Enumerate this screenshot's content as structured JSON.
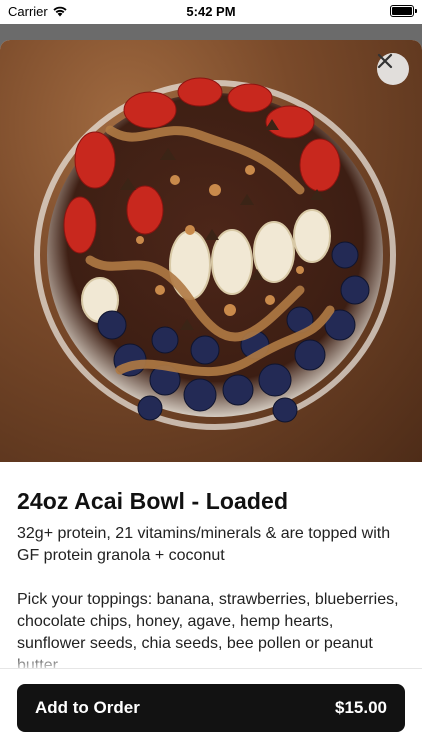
{
  "status_bar": {
    "carrier": "Carrier",
    "time": "5:42 PM",
    "battery_level": 1.0
  },
  "item": {
    "title": "24oz Acai Bowl - Loaded",
    "description": "32g+ protein, 21 vitamins/minerals & are topped with GF protein granola + coconut",
    "toppings": "Pick your toppings: banana, strawberries, blueberries, chocolate chips, honey, agave, hemp hearts, sunflower seeds, chia seeds, bee pollen or peanut butter"
  },
  "footer": {
    "add_label": "Add to Order",
    "price": "$15.00"
  },
  "icons": {
    "close": "close-icon",
    "wifi": "wifi-icon",
    "battery": "battery-icon"
  },
  "colors": {
    "button_bg": "#121212",
    "sheet_bg": "#ffffff"
  }
}
